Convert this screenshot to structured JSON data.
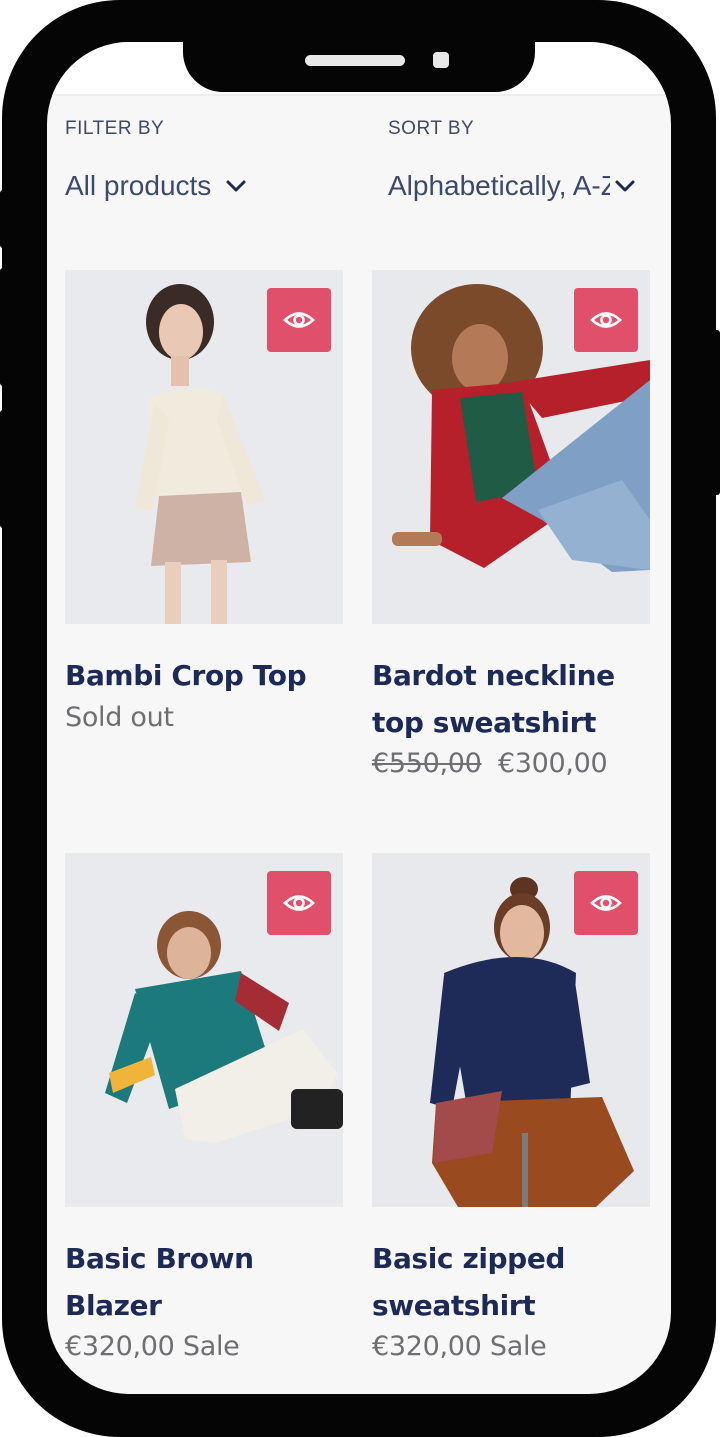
{
  "filters": {
    "filter_label": "FILTER BY",
    "filter_value": "All products",
    "sort_label": "SORT BY",
    "sort_value": "Alphabetically, A-Z"
  },
  "products": [
    {
      "title": "Bambi Crop Top",
      "status": "Sold out"
    },
    {
      "title": "Bardot neckline top sweatshirt",
      "compare_price": "€550,00",
      "price": "€300,00"
    },
    {
      "title": "Basic Brown Blazer",
      "price": "€320,00",
      "sale_label": "Sale"
    },
    {
      "title": "Basic zipped sweatshirt",
      "price": "€320,00",
      "sale_label": "Sale"
    }
  ],
  "icons": {
    "quick_view": "eye-icon",
    "dropdown": "chevron-down-icon"
  },
  "colors": {
    "accent": "#e0506b",
    "title_text": "#1d2a57",
    "muted_text": "#6f6f73",
    "label_text": "#3e4a6b",
    "screen_bg": "#f7f7f8",
    "device_frame": "#050505"
  }
}
